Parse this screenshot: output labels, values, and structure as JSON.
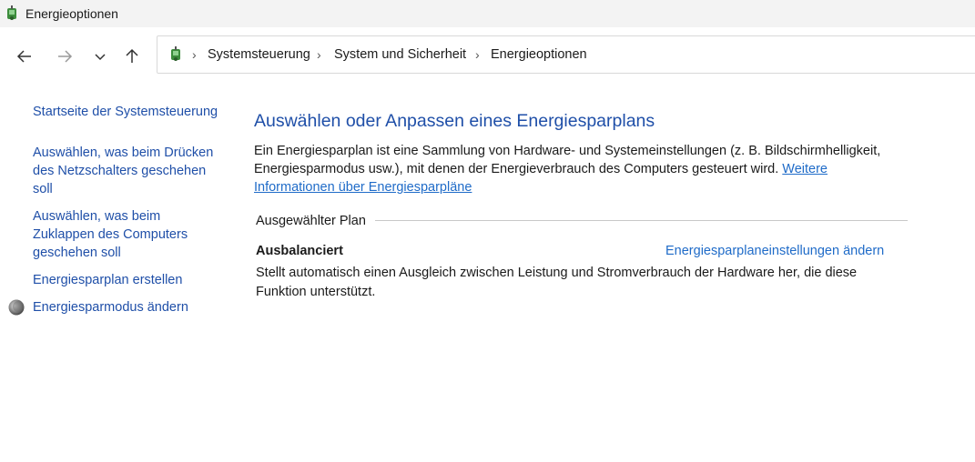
{
  "window": {
    "title": "Energieoptionen",
    "icon": "power-options-icon"
  },
  "nav": {
    "back": "arrow-left-icon",
    "forward": "arrow-right-icon",
    "recent": "chevron-down-icon",
    "up": "arrow-up-icon"
  },
  "breadcrumb": {
    "items": [
      "Systemsteuerung",
      "System und Sicherheit",
      "Energieoptionen"
    ],
    "separator": "›"
  },
  "sidebar": {
    "home": "Startseite der Systemsteuerung",
    "links": [
      "Auswählen, was beim Drücken des Netzschalters geschehen soll",
      "Auswählen, was beim Zuklappen des Computers geschehen soll",
      "Energiesparplan erstellen",
      "Energiesparmodus ändern"
    ],
    "sleep_icon": "moon-icon"
  },
  "main": {
    "heading": "Auswählen oder Anpassen eines Energiesparplans",
    "description": "Ein Energiesparplan ist eine Sammlung von Hardware- und Systemeinstellungen (z. B. Bildschirmhelligkeit, Energiesparmodus usw.), mit denen der Energieverbrauch des Computers gesteuert wird.",
    "more_link": "Weitere Informationen über Energiesparpläne",
    "group_label": "Ausgewählter Plan",
    "plan": {
      "name": "Ausbalanciert",
      "settings_link": "Energiesparplaneinstellungen ändern",
      "description": "Stellt automatisch einen Ausgleich zwischen Leistung und Stromverbrauch der Hardware her, die diese Funktion unterstützt."
    }
  },
  "colors": {
    "link": "#1f4fa8",
    "accent_link": "#1f6bc8",
    "titlebar": "#f3f3f3"
  }
}
